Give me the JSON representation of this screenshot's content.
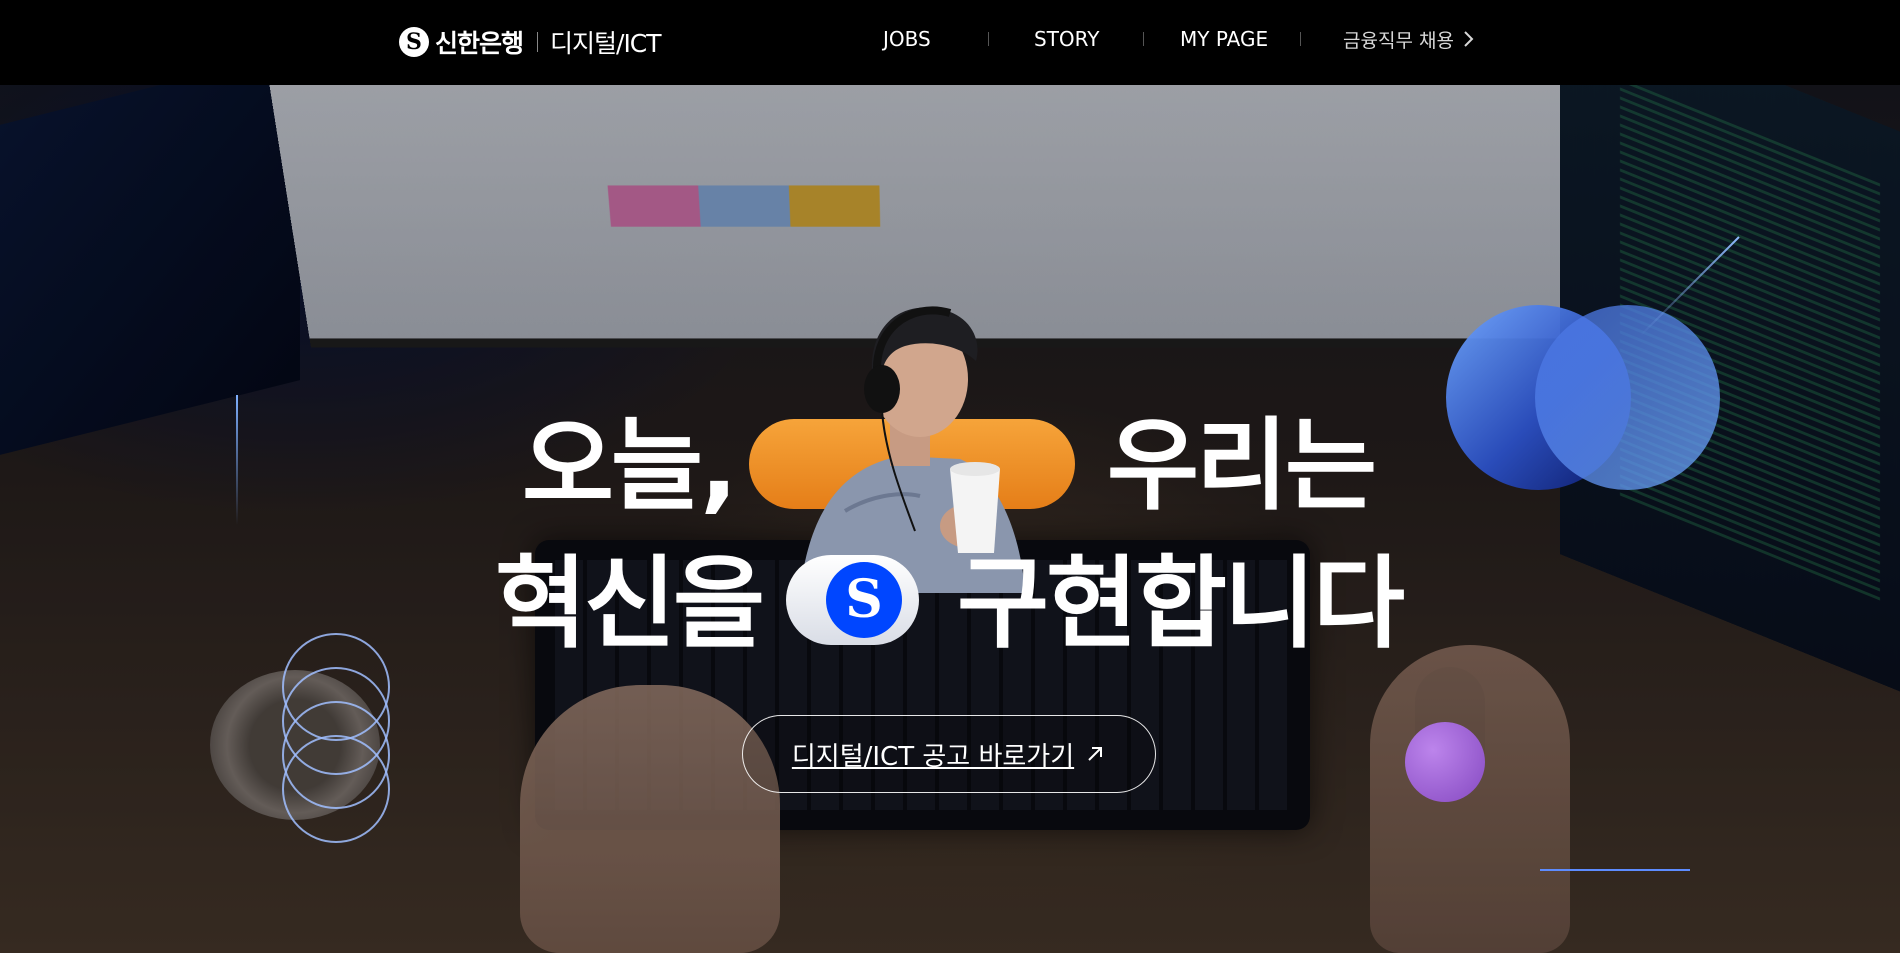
{
  "header": {
    "logo_mark": "S",
    "logo_name": "신한은행",
    "logo_sub": "디지털/ICT",
    "nav": {
      "jobs": "JOBS",
      "story": "STORY",
      "mypage": "MY PAGE",
      "finance": "금융직무 채용",
      "finance_icon": "chevron-right-icon"
    }
  },
  "hero": {
    "line1_left": "오늘,",
    "line1_right": "우리는",
    "line2_left": "혁신을",
    "line2_right": "구현합니다",
    "badge_mark": "S",
    "cta_label": "디지털/ICT 공고 바로가기",
    "cta_icon": "arrow-up-right-icon"
  },
  "colors": {
    "accent_orange": "#f39a2e",
    "brand_blue": "#0046ff",
    "orb_blue": "#5a8cff",
    "orb_purple": "#b27bff"
  }
}
